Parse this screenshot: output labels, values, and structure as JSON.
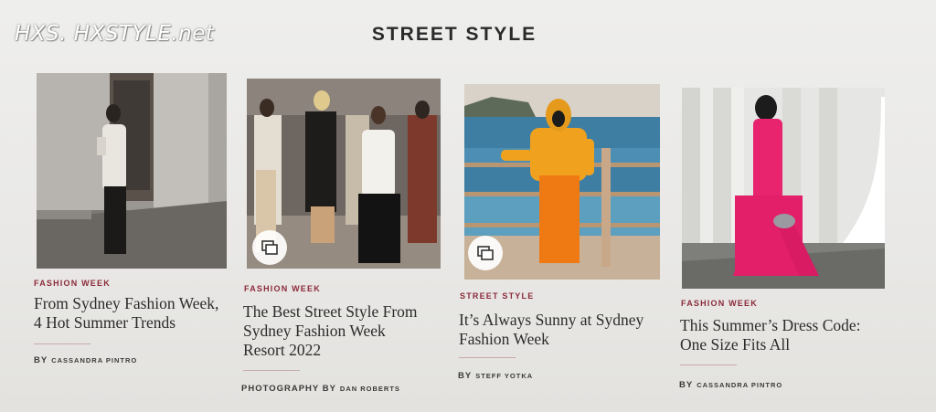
{
  "watermark": "HXS. HXSTYLE.net",
  "section_title": "STREET STYLE",
  "articles": [
    {
      "category": "FASHION WEEK",
      "headline_line1": "From Sydney Fashion Week,",
      "headline_line2": "4 Hot Summer Trends",
      "headline_line3": "",
      "byline_prefix": "BY",
      "author": "CASSANDRA PINTRO",
      "gallery": false
    },
    {
      "category": "FASHION WEEK",
      "headline_line1": "The Best Street Style From",
      "headline_line2": "Sydney Fashion Week",
      "headline_line3": "Resort 2022",
      "byline_prefix": "PHOTOGRAPHY BY",
      "author": "DAN ROBERTS",
      "gallery": true
    },
    {
      "category": "STREET STYLE",
      "headline_line1": "It’s Always Sunny at Sydney",
      "headline_line2": "Fashion Week",
      "headline_line3": "",
      "byline_prefix": "BY",
      "author": "STEFF YOTKA",
      "gallery": true
    },
    {
      "category": "FASHION WEEK",
      "headline_line1": "This Summer’s Dress Code:",
      "headline_line2": "One Size Fits All",
      "headline_line3": "",
      "byline_prefix": "BY",
      "author": "CASSANDRA PINTRO",
      "gallery": false
    }
  ],
  "colors": {
    "category": "#8b2a3a",
    "background": "#e9e8e6",
    "text": "#2c2c2c"
  },
  "icons": {
    "gallery": "gallery-stack-icon"
  }
}
